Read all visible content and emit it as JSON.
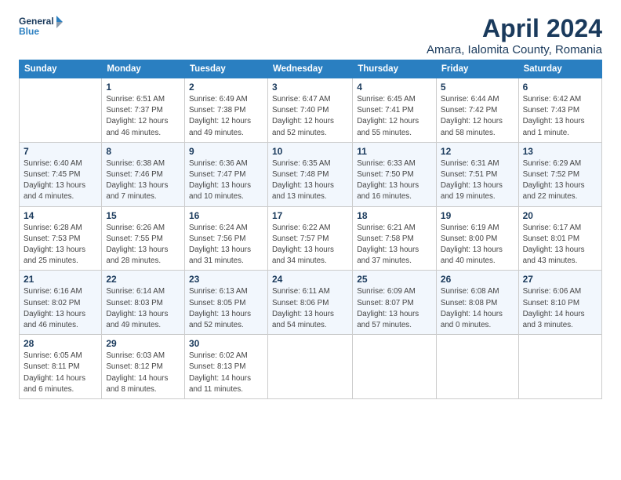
{
  "logo": {
    "line1": "General",
    "line2": "Blue"
  },
  "title": "April 2024",
  "subtitle": "Amara, Ialomita County, Romania",
  "weekdays": [
    "Sunday",
    "Monday",
    "Tuesday",
    "Wednesday",
    "Thursday",
    "Friday",
    "Saturday"
  ],
  "weeks": [
    [
      {
        "day": "",
        "detail": ""
      },
      {
        "day": "1",
        "detail": "Sunrise: 6:51 AM\nSunset: 7:37 PM\nDaylight: 12 hours\nand 46 minutes."
      },
      {
        "day": "2",
        "detail": "Sunrise: 6:49 AM\nSunset: 7:38 PM\nDaylight: 12 hours\nand 49 minutes."
      },
      {
        "day": "3",
        "detail": "Sunrise: 6:47 AM\nSunset: 7:40 PM\nDaylight: 12 hours\nand 52 minutes."
      },
      {
        "day": "4",
        "detail": "Sunrise: 6:45 AM\nSunset: 7:41 PM\nDaylight: 12 hours\nand 55 minutes."
      },
      {
        "day": "5",
        "detail": "Sunrise: 6:44 AM\nSunset: 7:42 PM\nDaylight: 12 hours\nand 58 minutes."
      },
      {
        "day": "6",
        "detail": "Sunrise: 6:42 AM\nSunset: 7:43 PM\nDaylight: 13 hours\nand 1 minute."
      }
    ],
    [
      {
        "day": "7",
        "detail": "Sunrise: 6:40 AM\nSunset: 7:45 PM\nDaylight: 13 hours\nand 4 minutes."
      },
      {
        "day": "8",
        "detail": "Sunrise: 6:38 AM\nSunset: 7:46 PM\nDaylight: 13 hours\nand 7 minutes."
      },
      {
        "day": "9",
        "detail": "Sunrise: 6:36 AM\nSunset: 7:47 PM\nDaylight: 13 hours\nand 10 minutes."
      },
      {
        "day": "10",
        "detail": "Sunrise: 6:35 AM\nSunset: 7:48 PM\nDaylight: 13 hours\nand 13 minutes."
      },
      {
        "day": "11",
        "detail": "Sunrise: 6:33 AM\nSunset: 7:50 PM\nDaylight: 13 hours\nand 16 minutes."
      },
      {
        "day": "12",
        "detail": "Sunrise: 6:31 AM\nSunset: 7:51 PM\nDaylight: 13 hours\nand 19 minutes."
      },
      {
        "day": "13",
        "detail": "Sunrise: 6:29 AM\nSunset: 7:52 PM\nDaylight: 13 hours\nand 22 minutes."
      }
    ],
    [
      {
        "day": "14",
        "detail": "Sunrise: 6:28 AM\nSunset: 7:53 PM\nDaylight: 13 hours\nand 25 minutes."
      },
      {
        "day": "15",
        "detail": "Sunrise: 6:26 AM\nSunset: 7:55 PM\nDaylight: 13 hours\nand 28 minutes."
      },
      {
        "day": "16",
        "detail": "Sunrise: 6:24 AM\nSunset: 7:56 PM\nDaylight: 13 hours\nand 31 minutes."
      },
      {
        "day": "17",
        "detail": "Sunrise: 6:22 AM\nSunset: 7:57 PM\nDaylight: 13 hours\nand 34 minutes."
      },
      {
        "day": "18",
        "detail": "Sunrise: 6:21 AM\nSunset: 7:58 PM\nDaylight: 13 hours\nand 37 minutes."
      },
      {
        "day": "19",
        "detail": "Sunrise: 6:19 AM\nSunset: 8:00 PM\nDaylight: 13 hours\nand 40 minutes."
      },
      {
        "day": "20",
        "detail": "Sunrise: 6:17 AM\nSunset: 8:01 PM\nDaylight: 13 hours\nand 43 minutes."
      }
    ],
    [
      {
        "day": "21",
        "detail": "Sunrise: 6:16 AM\nSunset: 8:02 PM\nDaylight: 13 hours\nand 46 minutes."
      },
      {
        "day": "22",
        "detail": "Sunrise: 6:14 AM\nSunset: 8:03 PM\nDaylight: 13 hours\nand 49 minutes."
      },
      {
        "day": "23",
        "detail": "Sunrise: 6:13 AM\nSunset: 8:05 PM\nDaylight: 13 hours\nand 52 minutes."
      },
      {
        "day": "24",
        "detail": "Sunrise: 6:11 AM\nSunset: 8:06 PM\nDaylight: 13 hours\nand 54 minutes."
      },
      {
        "day": "25",
        "detail": "Sunrise: 6:09 AM\nSunset: 8:07 PM\nDaylight: 13 hours\nand 57 minutes."
      },
      {
        "day": "26",
        "detail": "Sunrise: 6:08 AM\nSunset: 8:08 PM\nDaylight: 14 hours\nand 0 minutes."
      },
      {
        "day": "27",
        "detail": "Sunrise: 6:06 AM\nSunset: 8:10 PM\nDaylight: 14 hours\nand 3 minutes."
      }
    ],
    [
      {
        "day": "28",
        "detail": "Sunrise: 6:05 AM\nSunset: 8:11 PM\nDaylight: 14 hours\nand 6 minutes."
      },
      {
        "day": "29",
        "detail": "Sunrise: 6:03 AM\nSunset: 8:12 PM\nDaylight: 14 hours\nand 8 minutes."
      },
      {
        "day": "30",
        "detail": "Sunrise: 6:02 AM\nSunset: 8:13 PM\nDaylight: 14 hours\nand 11 minutes."
      },
      {
        "day": "",
        "detail": ""
      },
      {
        "day": "",
        "detail": ""
      },
      {
        "day": "",
        "detail": ""
      },
      {
        "day": "",
        "detail": ""
      }
    ]
  ]
}
